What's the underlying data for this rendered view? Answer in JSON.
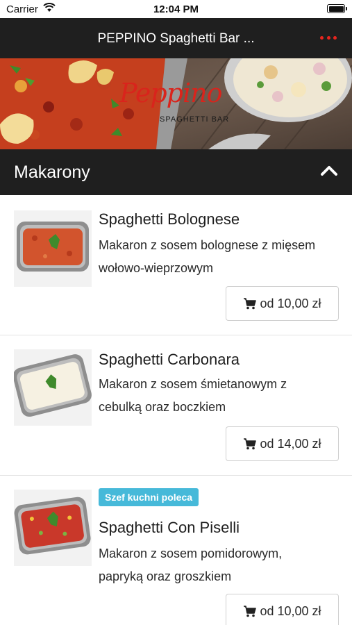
{
  "status_bar": {
    "carrier": "Carrier",
    "time": "12:04 PM"
  },
  "header": {
    "title": "PEPPINO Spaghetti Bar ..."
  },
  "banner": {
    "logo_text": "Peppino",
    "subtitle": "SPAGHETTI BAR"
  },
  "section": {
    "title": "Makarony"
  },
  "colors": {
    "accent": "#e8251e",
    "dark_bar": "#1f1f1f",
    "badge": "#46b9d9"
  },
  "items": [
    {
      "name": "Spaghetti Bolognese",
      "desc_line1": "Makaron z sosem bolognese z mięsem",
      "desc_line2": "wołowo-wieprzowym",
      "price": "od 10,00 zł"
    },
    {
      "name": "Spaghetti Carbonara",
      "desc_line1": "Makaron z sosem śmietanowym z",
      "desc_line2": "cebulką oraz boczkiem",
      "price": "od 14,00 zł"
    },
    {
      "name": "Spaghetti Con Piselli",
      "badge": "Szef kuchni poleca",
      "desc_line1": "Makaron z sosem pomidorowym,",
      "desc_line2": "papryką oraz groszkiem",
      "price": "od 10,00 zł"
    }
  ]
}
